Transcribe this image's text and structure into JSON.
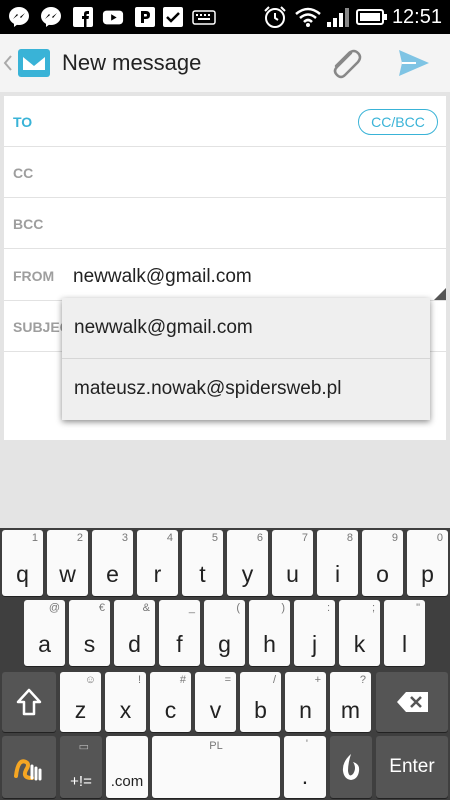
{
  "status_bar": {
    "time": "12:51",
    "icons": [
      "messenger-icon",
      "messenger-icon",
      "facebook-icon",
      "youtube-icon",
      "p-app-icon",
      "check-icon",
      "keyboard-icon",
      "alarm-icon",
      "wifi-icon",
      "signal-icon",
      "battery-icon"
    ]
  },
  "app_bar": {
    "title": "New message",
    "icons": [
      "back-chevron-icon",
      "inbox-app-icon",
      "attachment-icon",
      "send-icon"
    ]
  },
  "compose": {
    "to_label": "TO",
    "cc_bcc_button": "CC/BCC",
    "cc_label": "CC",
    "bcc_label": "BCC",
    "from_label": "FROM",
    "from_value": "newwalk@gmail.com",
    "subject_label": "SUBJEC"
  },
  "from_dropdown": {
    "options": [
      "newwalk@gmail.com",
      "mateusz.nowak@spidersweb.pl"
    ]
  },
  "keyboard": {
    "row1": [
      {
        "key": "q",
        "hint": "1"
      },
      {
        "key": "w",
        "hint": "2"
      },
      {
        "key": "e",
        "hint": "3"
      },
      {
        "key": "r",
        "hint": "4"
      },
      {
        "key": "t",
        "hint": "5"
      },
      {
        "key": "y",
        "hint": "6"
      },
      {
        "key": "u",
        "hint": "7"
      },
      {
        "key": "i",
        "hint": "8"
      },
      {
        "key": "o",
        "hint": "9"
      },
      {
        "key": "p",
        "hint": "0"
      }
    ],
    "row2": [
      {
        "key": "a",
        "hint": "@"
      },
      {
        "key": "s",
        "hint": "€"
      },
      {
        "key": "d",
        "hint": "&"
      },
      {
        "key": "f",
        "hint": "_"
      },
      {
        "key": "g",
        "hint": "("
      },
      {
        "key": "h",
        "hint": ")"
      },
      {
        "key": "j",
        "hint": ":"
      },
      {
        "key": "k",
        "hint": ";"
      },
      {
        "key": "l",
        "hint": "\""
      }
    ],
    "row3": [
      {
        "key": "z",
        "hint": "☺"
      },
      {
        "key": "x",
        "hint": "!"
      },
      {
        "key": "c",
        "hint": "#"
      },
      {
        "key": "v",
        "hint": "="
      },
      {
        "key": "b",
        "hint": "/"
      },
      {
        "key": "n",
        "hint": "+"
      },
      {
        "key": "m",
        "hint": "?"
      }
    ],
    "symbols_label": "+!=",
    "dotcom_label": ".com",
    "space_hint": "PL",
    "period_label": ".",
    "period_hint": "'",
    "enter_label": "Enter"
  },
  "colors": {
    "accent": "#39b3d7",
    "send": "#7fc4e4",
    "swype": "#f5a623"
  }
}
